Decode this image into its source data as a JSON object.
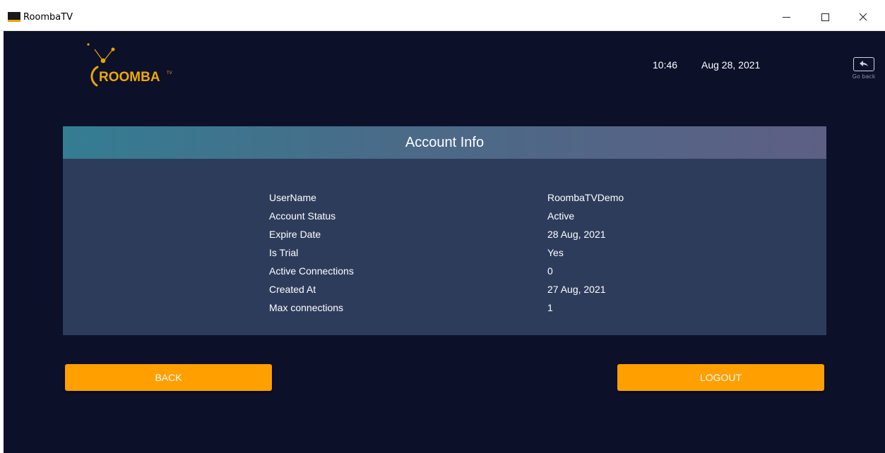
{
  "window": {
    "title": "RoombaTV"
  },
  "header": {
    "logo_text": "ROOMBA",
    "logo_suffix": "TV",
    "time": "10:46",
    "date": "Aug 28, 2021",
    "go_back_label": "Go back"
  },
  "account": {
    "title": "Account Info",
    "rows": [
      {
        "label": "UserName",
        "value": "RoombaTVDemo"
      },
      {
        "label": "Account Status",
        "value": "Active"
      },
      {
        "label": "Expire Date",
        "value": "28 Aug, 2021"
      },
      {
        "label": "Is Trial",
        "value": "Yes"
      },
      {
        "label": "Active Connections",
        "value": "0"
      },
      {
        "label": "Created At",
        "value": "27 Aug, 2021"
      },
      {
        "label": "Max connections",
        "value": "1"
      }
    ]
  },
  "buttons": {
    "back_label": "BACK",
    "logout_label": "LOGOUT"
  },
  "colors": {
    "background": "#0c1029",
    "card": "#2e3c5c",
    "accent": "#ff9f00"
  }
}
